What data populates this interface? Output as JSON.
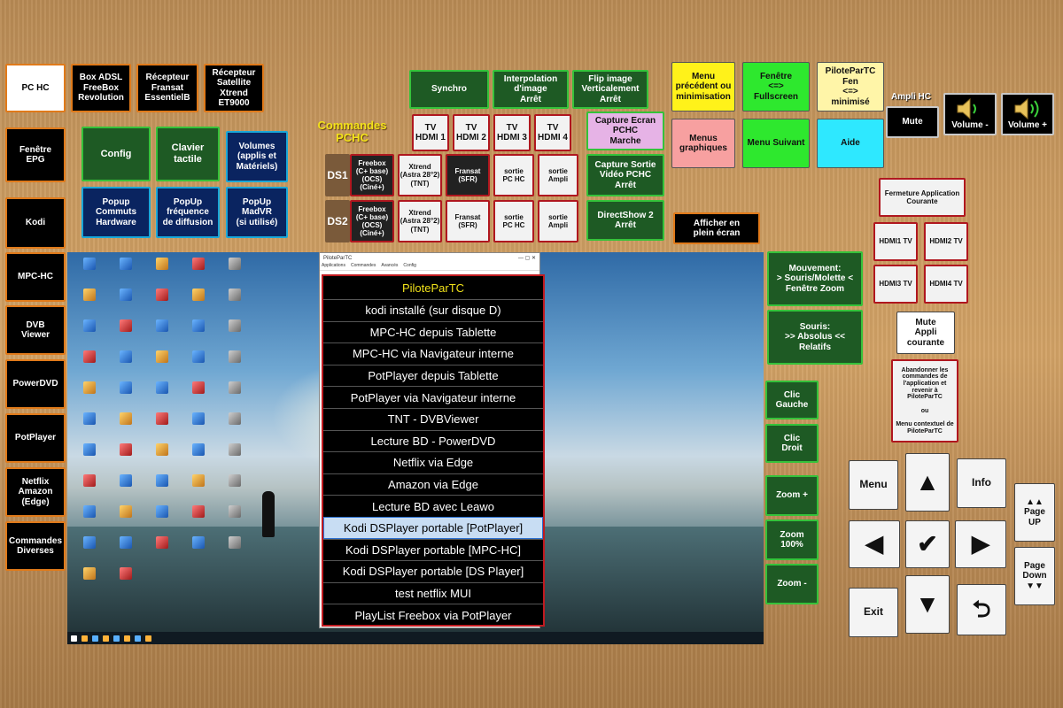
{
  "left_column": {
    "pc_hc": "PC HC",
    "box_adsl": "Box ADSL\nFreeBox\nRevolution",
    "recepteur_fransat": "Récepteur\nFransat\nEssentielB",
    "recepteur_satellite": "Récepteur\nSatellite\nXtrend\nET9000",
    "fenetre_epg": "Fenêtre\nEPG",
    "kodi": "Kodi",
    "mpc_hc": "MPC-HC",
    "dvb_viewer": "DVB\nViewer",
    "powerdvd": "PowerDVD",
    "potplayer": "PotPlayer",
    "netflix_amazon": "Netflix\nAmazon\n(Edge)",
    "commandes_diverses": "Commandes\nDiverses"
  },
  "config_group": {
    "config": "Config",
    "clavier": "Clavier\ntactile",
    "volumes": "Volumes\n(applis et\nMatériels)",
    "popup_commuts": "Popup\nCommuts\nHardware",
    "popup_frequence": "PopUp\nfréquence\nde diffusion",
    "popup_madvr": "PopUp\nMadVR\n(si utilisé)"
  },
  "commandes": {
    "title": "Commandes\nPCHC",
    "synchro": "Synchro",
    "interpolation": "Interpolation\nd'image\nArrêt",
    "flip": "Flip image\nVerticalement\nArrêt",
    "tv_hdmi1": "TV\nHDMI 1",
    "tv_hdmi2": "TV\nHDMI 2",
    "tv_hdmi3": "TV\nHDMI 3",
    "tv_hdmi4": "TV\nHDMI 4",
    "capture_ecran": "Capture Ecran\nPCHC\nMarche",
    "capture_sortie": "Capture Sortie\nVidéo PCHC\nArrêt",
    "directshow": "DirectShow 2\nArrêt",
    "afficher_plein": "Afficher en\nplein écran",
    "ds1": "DS1",
    "ds2": "DS2",
    "ds1_freebox": "Freebox\n(C+ base)\n(OCS)\n(Ciné+)",
    "ds1_xtrend": "Xtrend\n(Astra 28°2)\n(TNT)",
    "ds1_fransat": "Fransat\n(SFR)",
    "ds1_sortie_pc": "sortie\nPC HC",
    "ds1_sortie_ampli": "sortie\nAmpli",
    "ds2_freebox": "Freebox\n(C+ base)\n(OCS)\n(Ciné+)",
    "ds2_xtrend": "Xtrend\n(Astra 28°2)\n(TNT)",
    "ds2_fransat": "Fransat\n(SFR)",
    "ds2_sortie_pc": "sortie\nPC HC",
    "ds2_sortie_ampli": "sortie\nAmpli"
  },
  "top_right": {
    "menu_prec": "Menu\nprécédent ou\nminimisation",
    "fenetre_full": "Fenêtre\n<=>\nFullscreen",
    "pilote_fen": "PiloteParTC\nFen\n<=>\nminimisé",
    "menus_graphiques": "Menus\ngraphiques",
    "menu_suivant": "Menu Suivant",
    "aide": "Aide",
    "ampli_label": "Ampli HC",
    "mute": "Mute",
    "volume_minus": "Volume -",
    "volume_plus": "Volume +"
  },
  "right_panel": {
    "fermeture": "Fermeture Application\nCourante",
    "hdmi1_tv": "HDMI1 TV",
    "hdmi2_tv": "HDMI2 TV",
    "hdmi3_tv": "HDMI3 TV",
    "hdmi4_tv": "HDMI4 TV",
    "mute_appli": "Mute\nAppli\ncourante",
    "abandonner": "Abandonner les\ncommandes de\nl'application et\nrevenir à\nPiloteParTC\n\nou\n\nMenu contextuel de\nPiloteParTC",
    "mouvement": "Mouvement:\n> Souris/Molette <\nFenêtre Zoom",
    "souris": "Souris:\n>> Absolus <<\nRelatifs",
    "clic_gauche": "Clic\nGauche",
    "clic_droit": "Clic\nDroit",
    "zoom_plus": "Zoom +",
    "zoom_100": "Zoom\n100%",
    "zoom_minus": "Zoom -"
  },
  "navpad": {
    "menu": "Menu",
    "info": "Info",
    "exit": "Exit",
    "up": "▲",
    "down": "▼",
    "left": "◀",
    "right": "▶",
    "ok": "✔",
    "back": "⮌",
    "page_up": "▲▲\nPage\nUP",
    "page_down": "Page\nDown\n▼▼"
  },
  "desktop": {
    "window_title": "PiloteParTC",
    "window_menu": [
      "Applications",
      "Commandes",
      "Avancés",
      "Config"
    ],
    "menu_title": "PiloteParTC",
    "menu_items": [
      "kodi installé (sur disque D)",
      "MPC-HC depuis Tablette",
      "MPC-HC via Navigateur interne",
      "PotPlayer depuis Tablette",
      "PotPlayer via Navigateur interne",
      "TNT - DVBViewer",
      "Lecture BD - PowerDVD",
      "Netflix via Edge",
      "Amazon via Edge",
      "Lecture BD avec Leawo",
      "Kodi DSPlayer portable [PotPlayer]",
      "Kodi DSPlayer portable [MPC-HC]",
      "Kodi DSPlayer portable [DS Player]",
      "test netflix MUI",
      "PlayList Freebox via PotPlayer"
    ],
    "selected_index": 10
  },
  "colors": {
    "orange_border": "#e07a1a",
    "green_border": "#35c23a",
    "blue_border": "#1aa7d8",
    "red_border": "#b0171f",
    "menu_title_yellow": "#f0e11a"
  }
}
